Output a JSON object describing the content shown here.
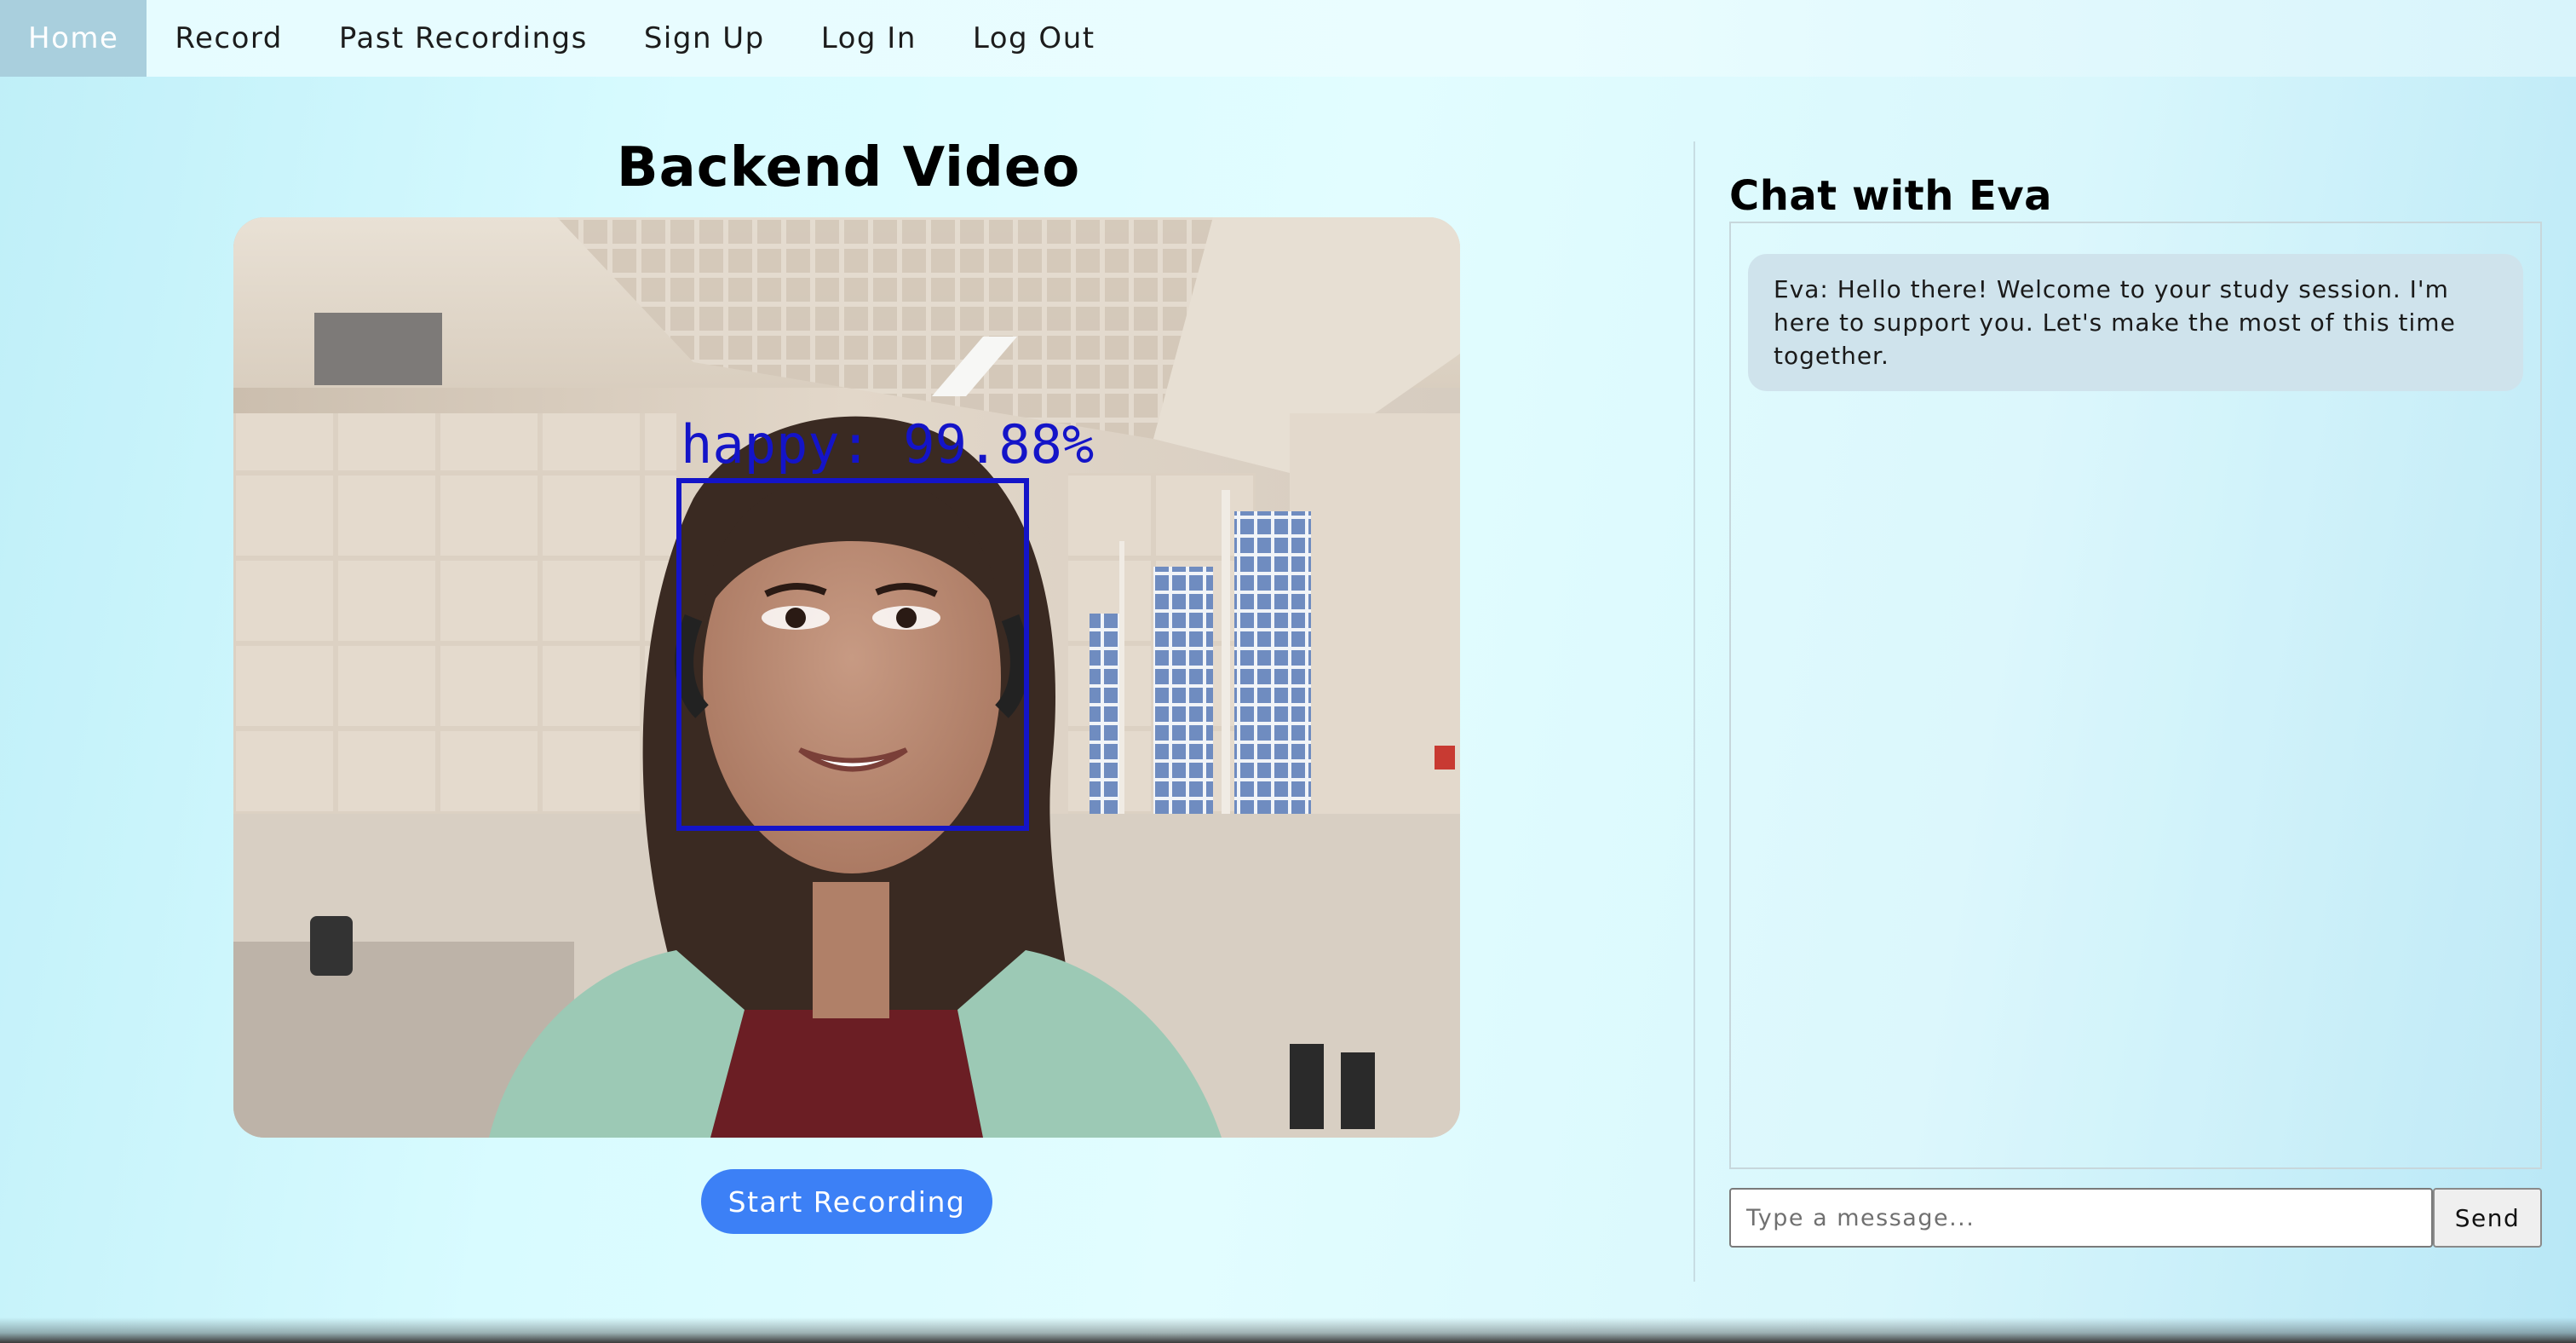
{
  "nav": {
    "items": [
      {
        "label": "Home",
        "active": true
      },
      {
        "label": "Record",
        "active": false
      },
      {
        "label": "Past Recordings",
        "active": false
      },
      {
        "label": "Sign Up",
        "active": false
      },
      {
        "label": "Log In",
        "active": false
      },
      {
        "label": "Log Out",
        "active": false
      }
    ]
  },
  "video": {
    "title": "Backend Video",
    "emotion_label": "happy: 99.88%",
    "record_button_label": "Start Recording"
  },
  "chat": {
    "title": "Chat with Eva",
    "messages": [
      {
        "text": "Eva: Hello there! Welcome to your study session. I'm here to support you. Let's make the most of this time together."
      }
    ],
    "input_placeholder": "Type a message...",
    "send_label": "Send"
  },
  "colors": {
    "accent": "#3c80f6",
    "face_box": "#1414c8",
    "nav_active": "#a9cfdd",
    "chat_bubble": "#cfe3ec"
  }
}
